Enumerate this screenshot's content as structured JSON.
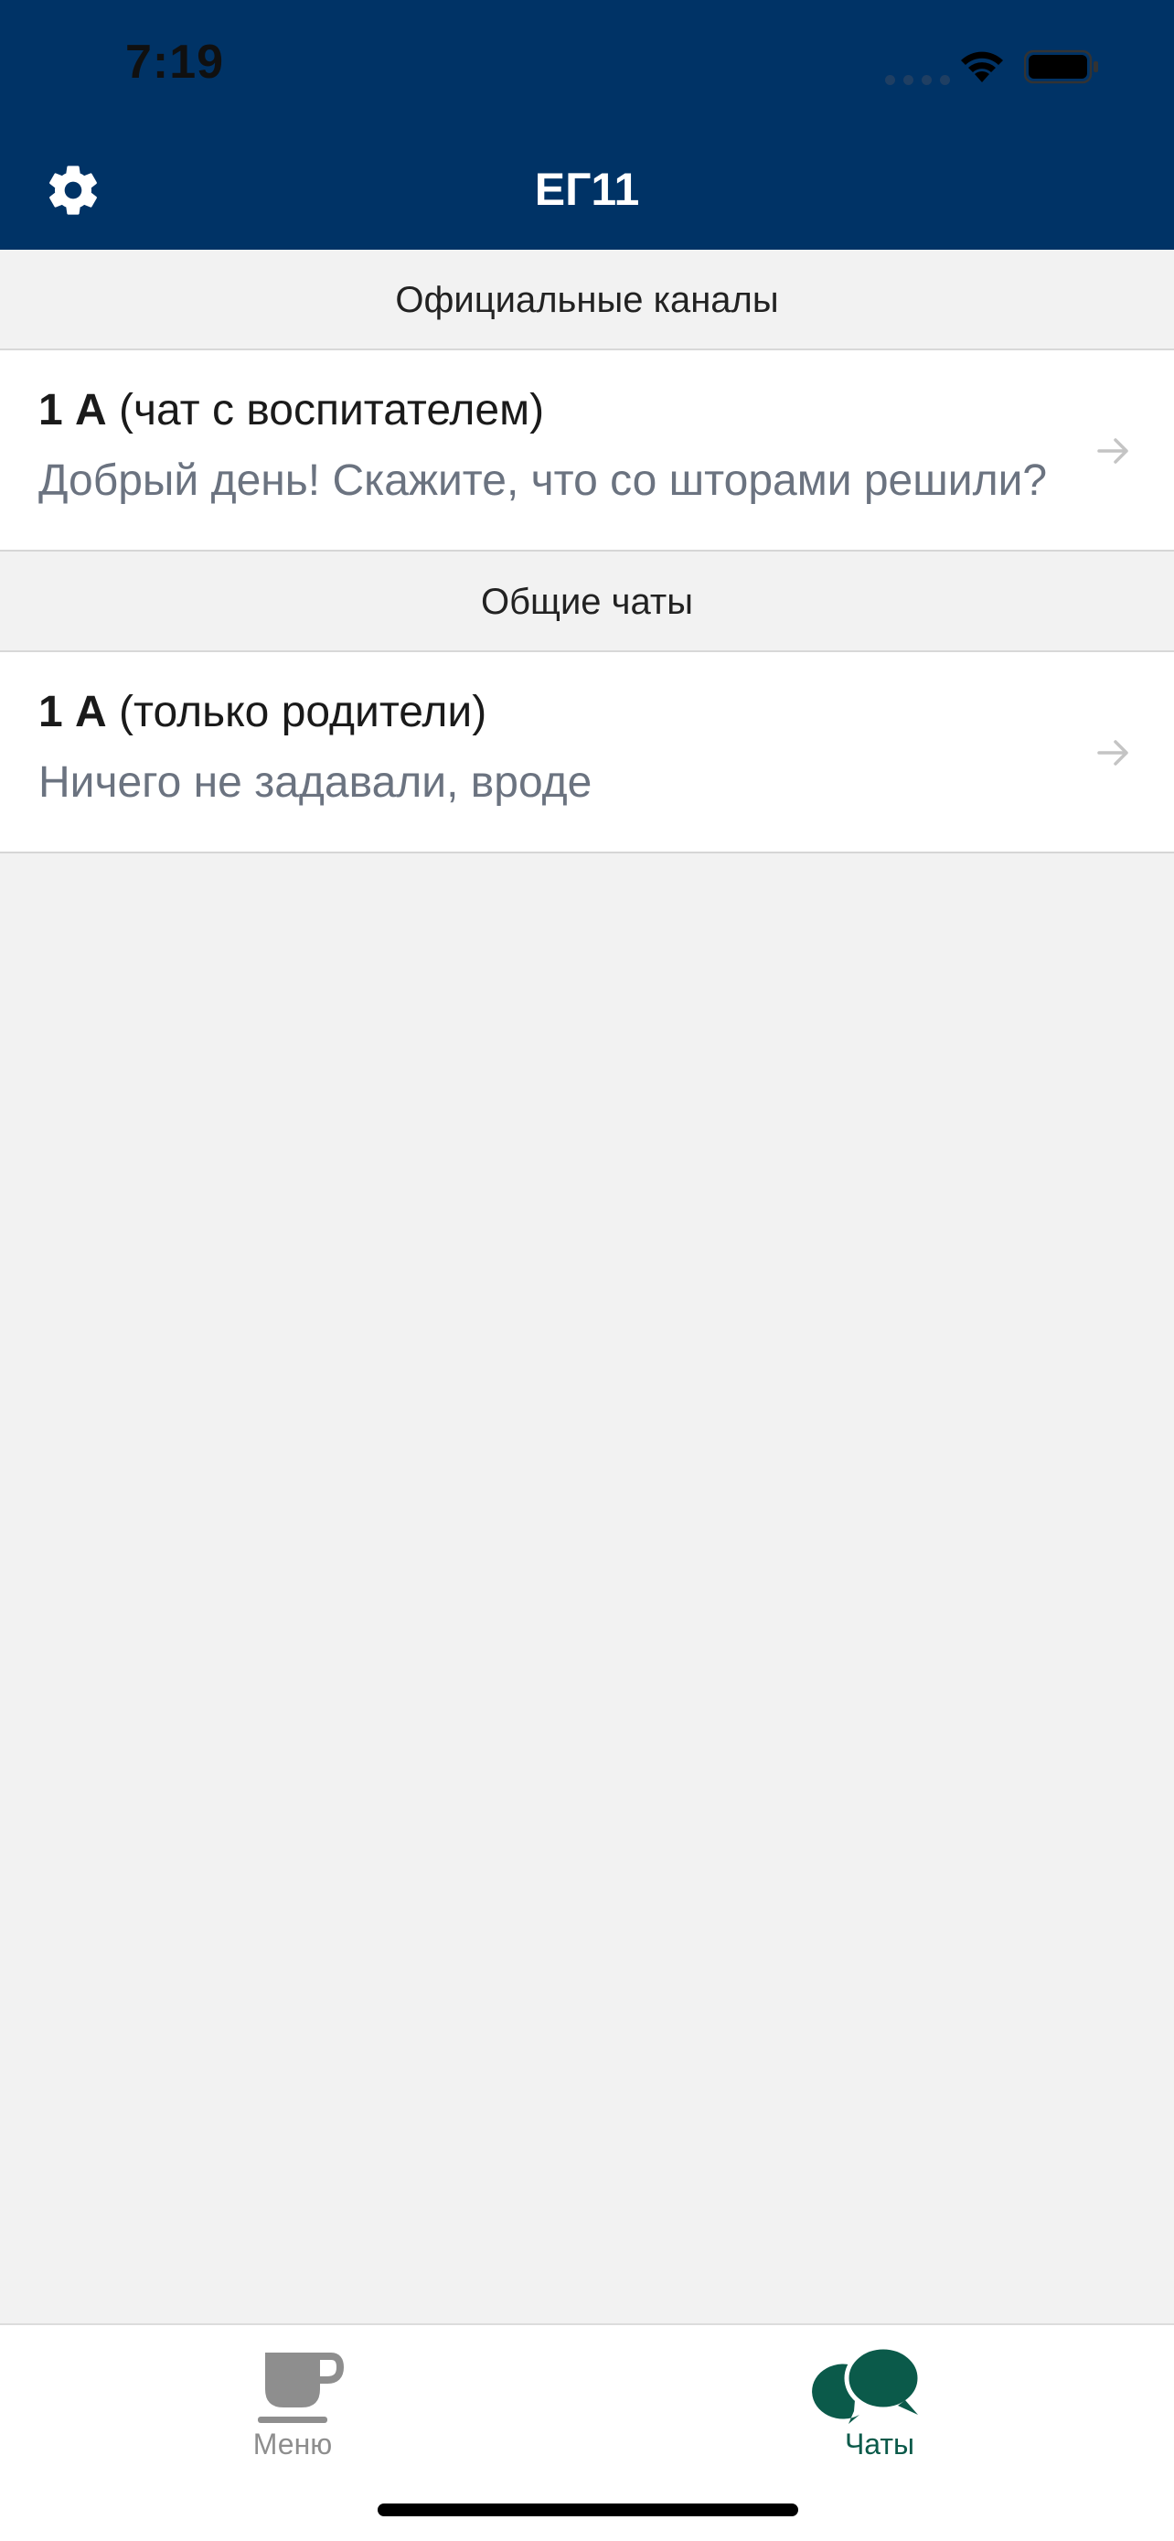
{
  "status_bar": {
    "time": "7:19"
  },
  "header": {
    "title": "ЕГ11",
    "settings_icon": "gear-icon",
    "background_color": "#003366"
  },
  "sections": [
    {
      "title": "Официальные каналы",
      "chats": [
        {
          "title_bold": "1 А",
          "title_rest": " (чат с воспитателем)",
          "preview": "Добрый день! Скажите, что со шторами решили?"
        }
      ]
    },
    {
      "title": "Общие чаты",
      "chats": [
        {
          "title_bold": "1 А",
          "title_rest": " (только родители)",
          "preview": "Ничего не задавали, вроде"
        }
      ]
    }
  ],
  "tabbar": {
    "tabs": [
      {
        "label": "Меню",
        "icon": "cup-icon",
        "active": false
      },
      {
        "label": "Чаты",
        "icon": "chat-bubbles-icon",
        "active": true
      }
    ],
    "active_color": "#0b5a4a",
    "inactive_color": "#8e8e8e"
  }
}
